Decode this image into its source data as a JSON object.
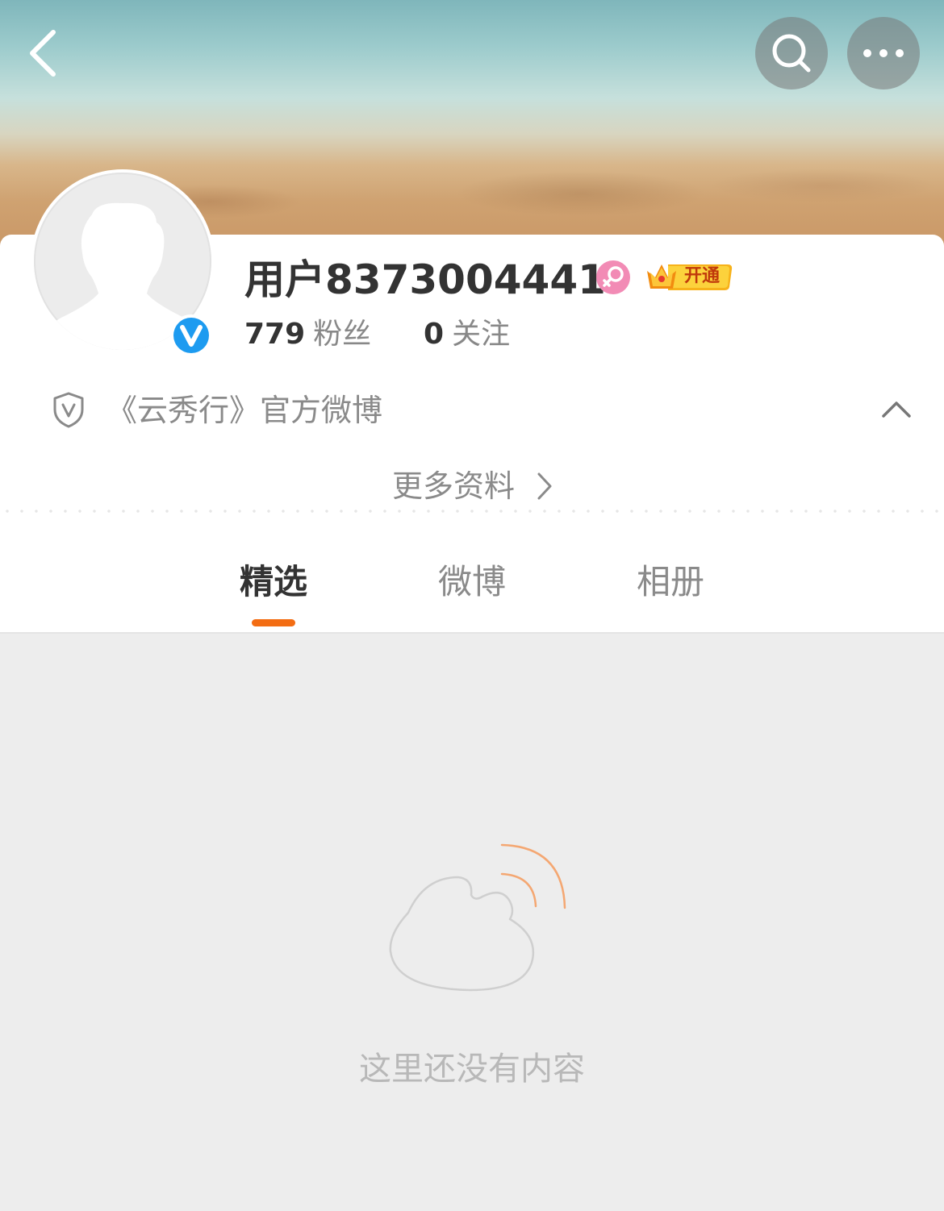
{
  "header": {
    "back_icon": "chevron-left-icon",
    "search_icon": "search-icon",
    "more_icon": "more-horizontal-icon"
  },
  "profile": {
    "name": "用户8373004441",
    "gender_icon": "female-icon",
    "vip_badge_label": "开通",
    "verified_icon": "verified-v-icon",
    "followers_count": "779",
    "followers_label": "粉丝",
    "following_count": "0",
    "following_label": "关注",
    "description": "《云秀行》官方微博",
    "more_info_label": "更多资料"
  },
  "tabs": [
    {
      "label": "精选",
      "active": true
    },
    {
      "label": "微博",
      "active": false
    },
    {
      "label": "相册",
      "active": false
    }
  ],
  "empty_state": {
    "message": "这里还没有内容"
  },
  "colors": {
    "accent": "#f36d13",
    "verified_blue": "#1d9bf0",
    "female_pink": "#f28bb5"
  }
}
